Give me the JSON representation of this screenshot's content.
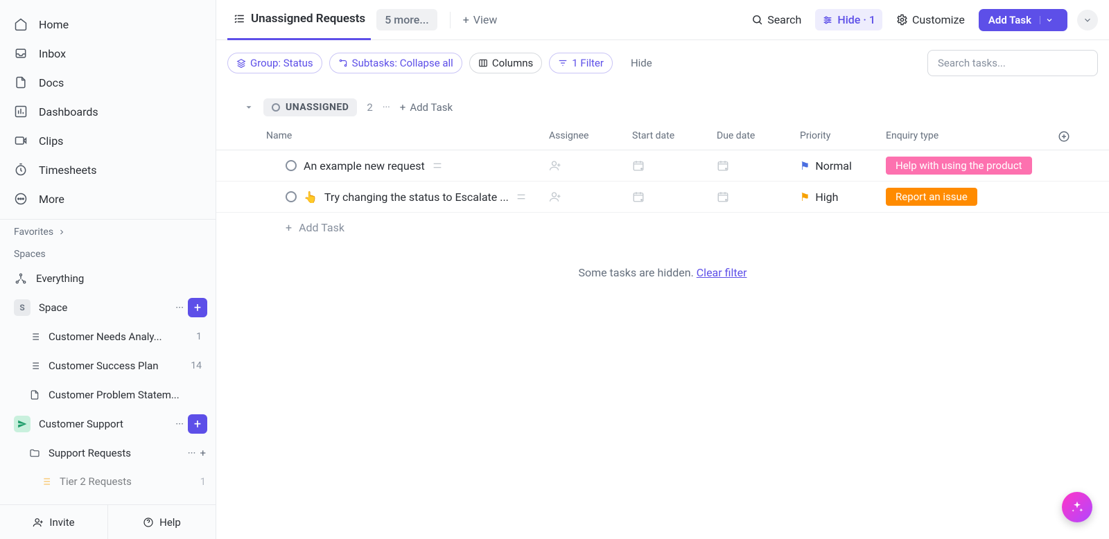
{
  "sidebar": {
    "nav": [
      {
        "label": "Home"
      },
      {
        "label": "Inbox"
      },
      {
        "label": "Docs"
      },
      {
        "label": "Dashboards"
      },
      {
        "label": "Clips"
      },
      {
        "label": "Timesheets"
      },
      {
        "label": "More"
      }
    ],
    "favorites_label": "Favorites",
    "spaces_label": "Spaces",
    "everything_label": "Everything",
    "space_name": "Space",
    "space_initial": "S",
    "space_lists": [
      {
        "label": "Customer Needs Analy...",
        "count": "1"
      },
      {
        "label": "Customer Success Plan",
        "count": "14"
      },
      {
        "label": "Customer Problem Statem...",
        "count": ""
      }
    ],
    "support_space": "Customer Support",
    "support_folder": "Support Requests",
    "tier2": {
      "label": "Tier 2 Requests",
      "count": "1"
    },
    "invite": "Invite",
    "help": "Help"
  },
  "topbar": {
    "view_name": "Unassigned Requests",
    "more": "5 more...",
    "add_view": "View",
    "search": "Search",
    "hide": "Hide · 1",
    "customize": "Customize",
    "add_task": "Add Task"
  },
  "toolbar": {
    "group": "Group: Status",
    "subtasks": "Subtasks: Collapse all",
    "columns": "Columns",
    "filter": "1 Filter",
    "hide": "Hide",
    "search_placeholder": "Search tasks..."
  },
  "group": {
    "status": "UNASSIGNED",
    "count": "2",
    "add": "Add Task"
  },
  "columns": {
    "name": "Name",
    "assignee": "Assignee",
    "start": "Start date",
    "due": "Due date",
    "priority": "Priority",
    "enquiry": "Enquiry type"
  },
  "rows": [
    {
      "name": "An example new request",
      "emoji": "",
      "priority": "Normal",
      "flag": "blue",
      "enquiry": "Help with using the product",
      "enquiry_class": "enquiry-pink"
    },
    {
      "name": "Try changing the status to Escalate ...",
      "emoji": "👆",
      "priority": "High",
      "flag": "orange",
      "enquiry": "Report an issue",
      "enquiry_class": "enquiry-orange"
    }
  ],
  "add_task_row": "Add Task",
  "hidden_msg": "Some tasks are hidden. ",
  "clear_filter": "Clear filter"
}
